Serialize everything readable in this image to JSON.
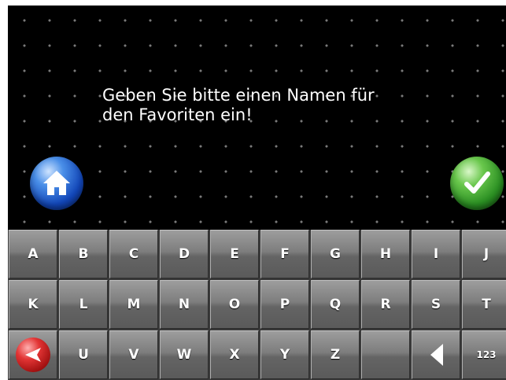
{
  "dialog": {
    "message": "Geben Sie bitte einen Namen für\nden Favoriten ein!"
  },
  "buttons": {
    "home_icon": "home-icon",
    "confirm_icon": "checkmark-icon"
  },
  "keyboard": {
    "row1": [
      "A",
      "B",
      "C",
      "D",
      "E",
      "F",
      "G",
      "H",
      "I",
      "J"
    ],
    "row2": [
      "K",
      "L",
      "M",
      "N",
      "O",
      "P",
      "Q",
      "R",
      "S",
      "T"
    ],
    "row3": [
      "U",
      "V",
      "W",
      "X",
      "Y",
      "Z"
    ],
    "numbers_key": "123",
    "back_icon": "back-arrow-icon",
    "backspace_icon": "left-arrow-icon"
  },
  "colors": {
    "home_button": "#1f5fd0",
    "confirm_button": "#3a9e2a",
    "back_button": "#d22a2a",
    "key_face": "#7d7d7d"
  }
}
